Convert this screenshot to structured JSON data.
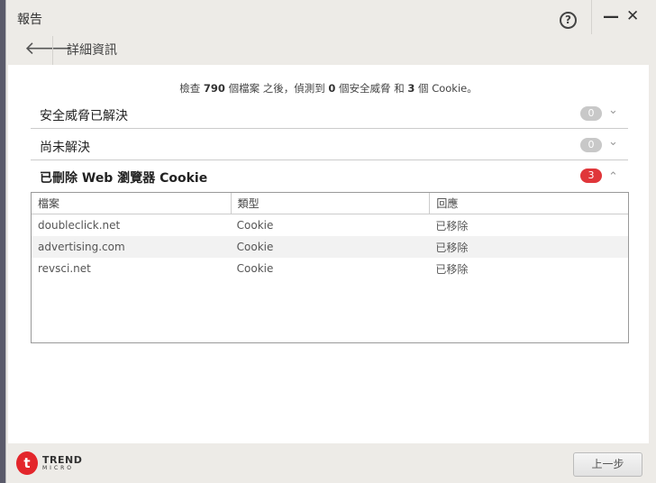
{
  "window": {
    "title": "報告",
    "help": "?",
    "minimize": "—",
    "close": "✕"
  },
  "header": {
    "back": "🡐",
    "subtitle": "詳細資訊"
  },
  "summary": {
    "p1": "檢查 ",
    "files": "790",
    "p2": " 個檔案 之後，偵測到 ",
    "threats": "0",
    "p3": " 個安全威脅 和 ",
    "cookies": "3",
    "p4": " 個 Cookie。"
  },
  "sections": [
    {
      "label": "安全威脅已解決",
      "count": "0",
      "chevron": "⌄"
    },
    {
      "label": "尚未解決",
      "count": "0",
      "chevron": "⌄"
    },
    {
      "label": "已刪除 Web 瀏覽器 Cookie",
      "count": "3",
      "chevron": "⌃"
    }
  ],
  "table": {
    "headers": [
      "檔案",
      "類型",
      "回應"
    ],
    "rows": [
      [
        "doubleclick.net",
        "Cookie",
        "已移除"
      ],
      [
        "advertising.com",
        "Cookie",
        "已移除"
      ],
      [
        "revsci.net",
        "Cookie",
        "已移除"
      ]
    ]
  },
  "footer": {
    "logo_top": "TREND",
    "logo_bottom": "MICRO",
    "back_button": "上一步"
  },
  "colors": {
    "accent_red": "#e0363a"
  }
}
